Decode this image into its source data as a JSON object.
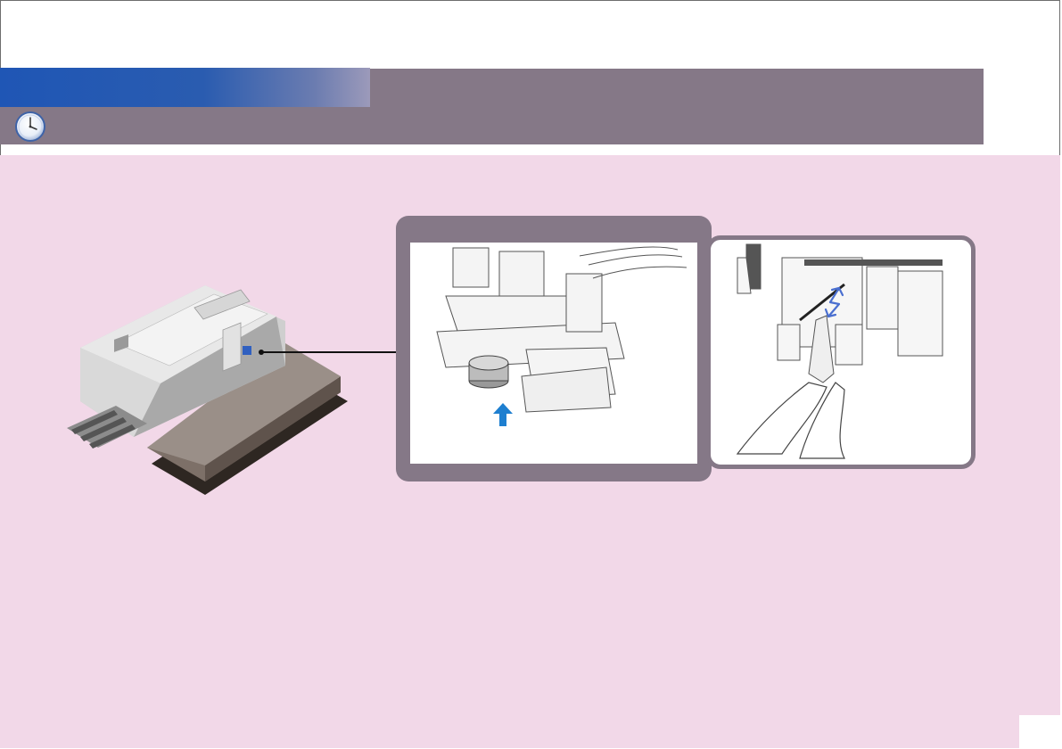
{
  "document": {
    "header": {
      "title": "",
      "subtitle": ""
    },
    "colors": {
      "header_blue": "#1f56b5",
      "header_gray": "#857887",
      "content_background": "#f2d8e8",
      "arrow_blue": "#1e7fd0"
    },
    "icons": {
      "header": "clock-icon",
      "step1_motion": "up-arrow-icon",
      "step2_motion": "double-arrow-icon"
    },
    "illustrations": {
      "overview": "printer-illustration",
      "step1": "detail-closeup-illustration",
      "step2": "cleaning-with-cloth-illustration"
    }
  }
}
